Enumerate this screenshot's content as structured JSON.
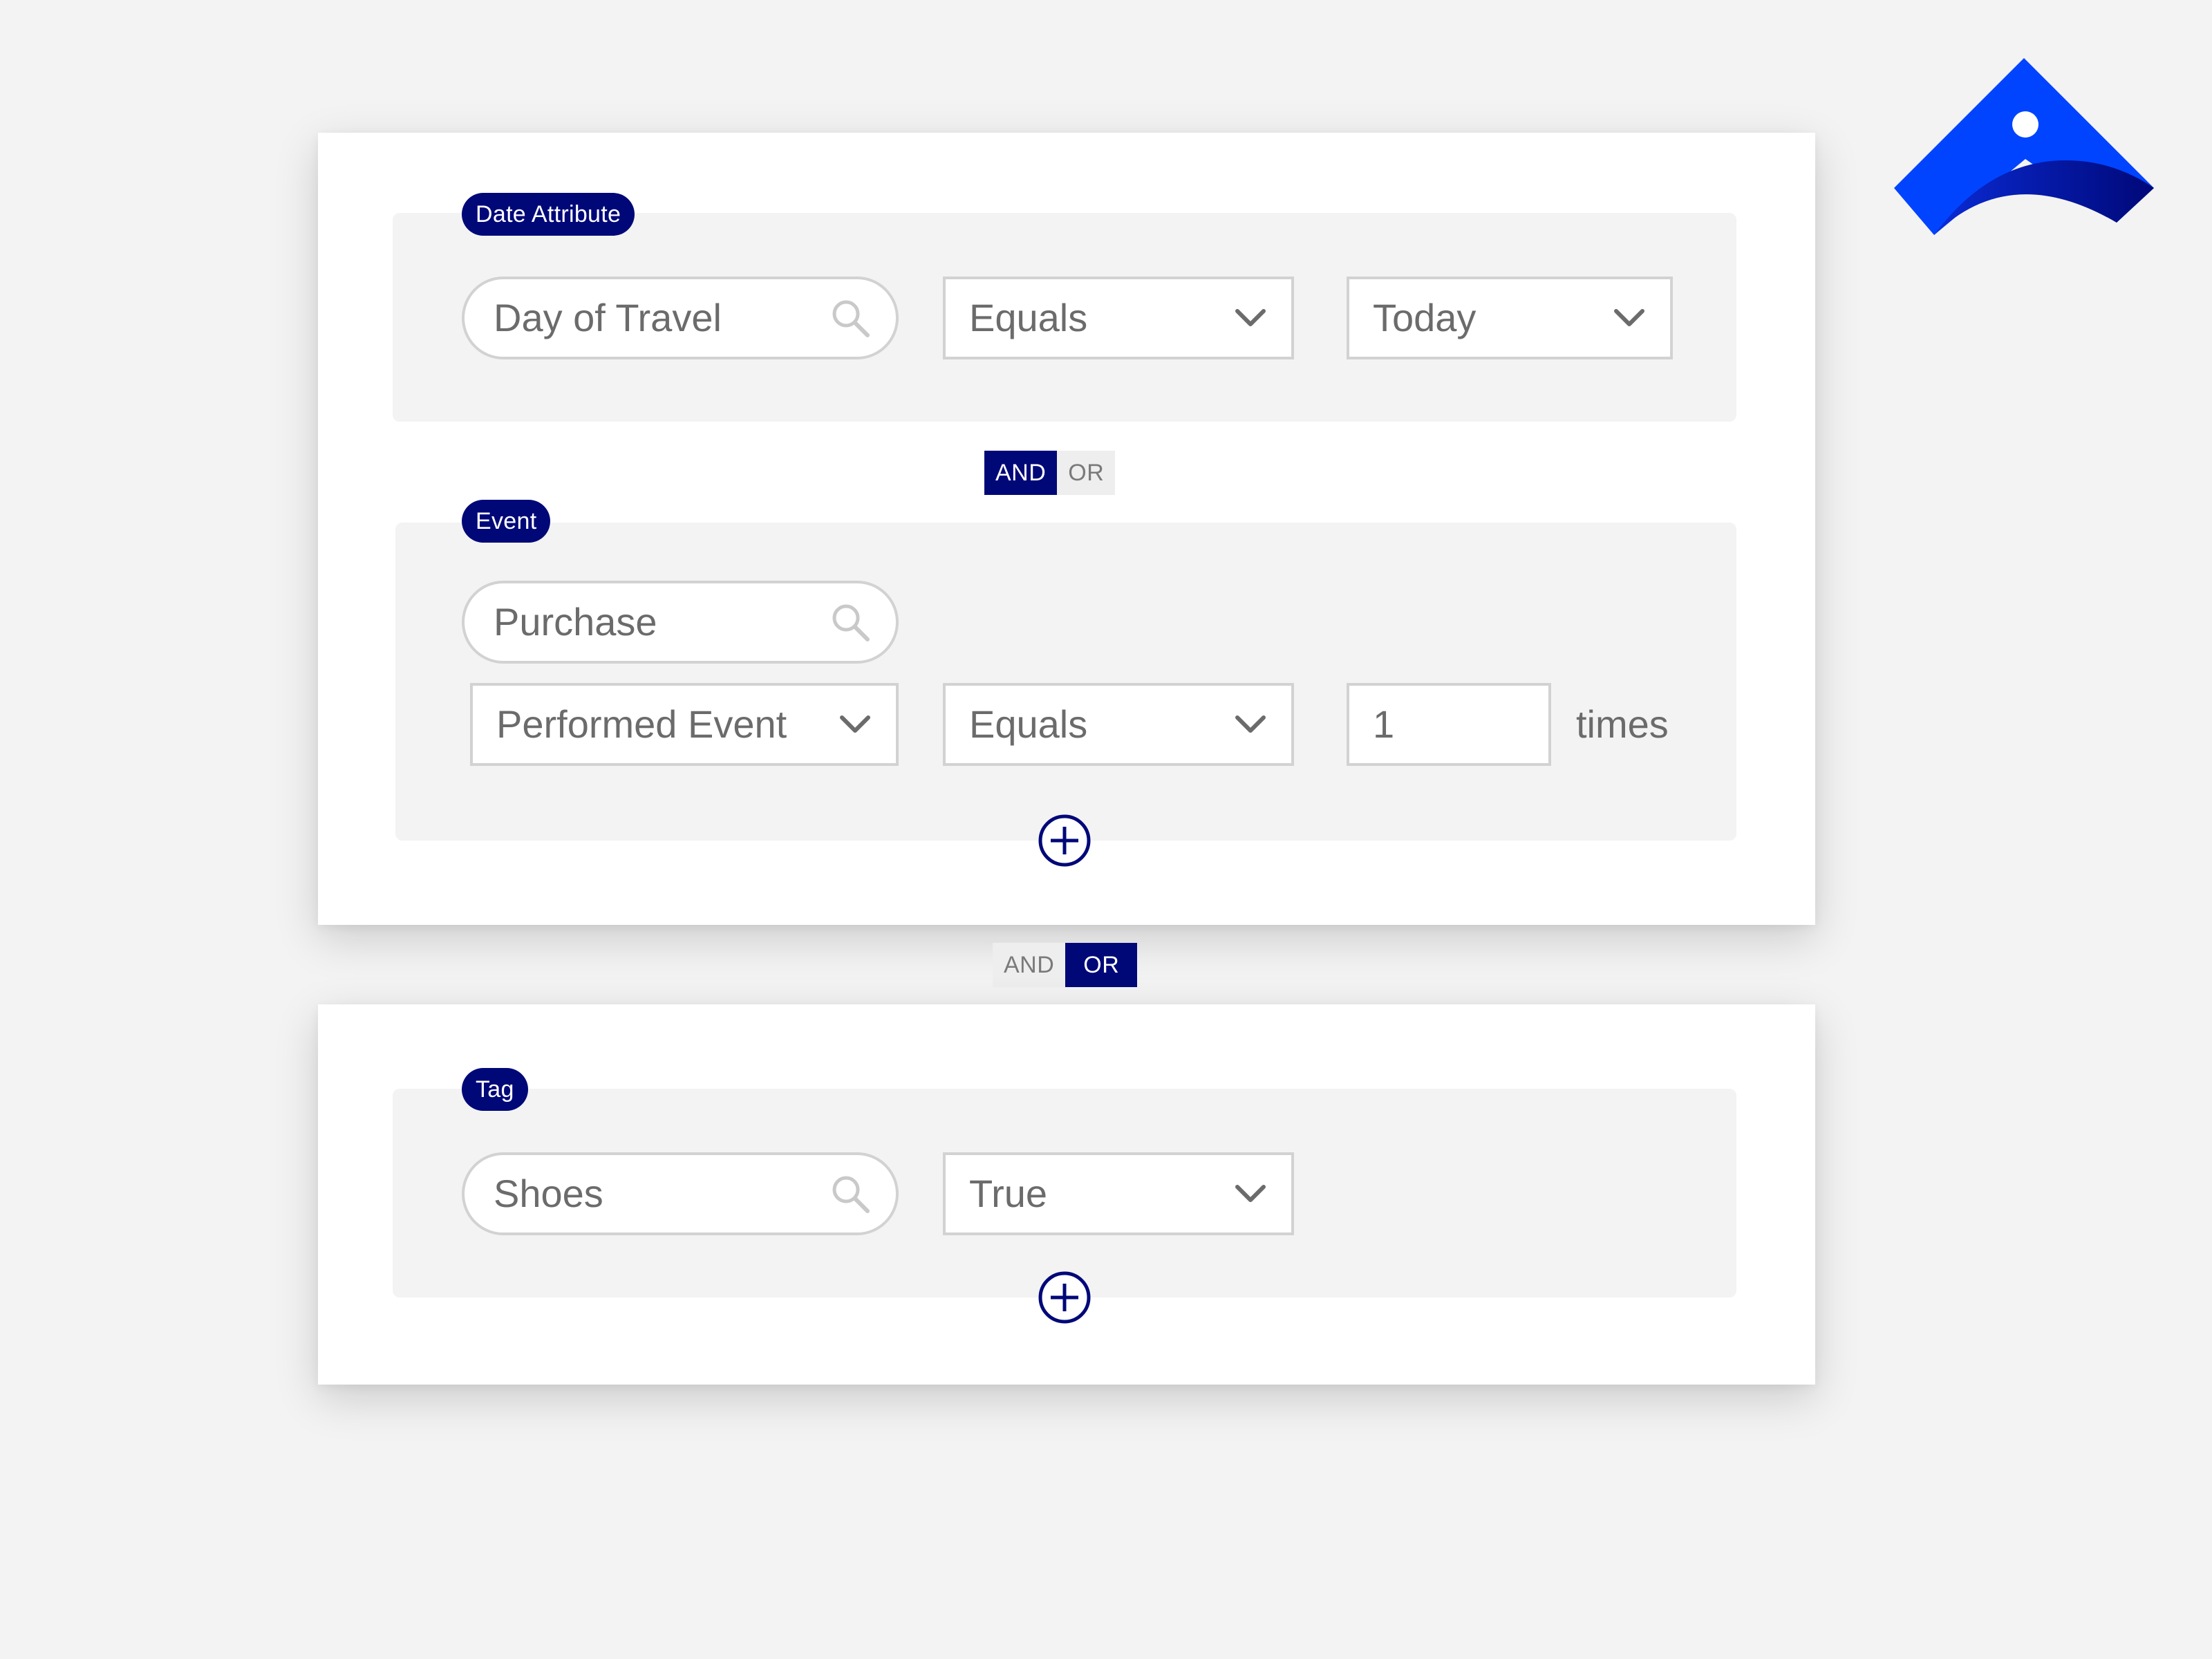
{
  "colors": {
    "background": "#f3f3f3",
    "panel": "#ffffff",
    "accent_navy": "#000878",
    "brand_blue": "#0044ff",
    "field_border": "#d2d2d2",
    "text_muted": "#6b6b6b"
  },
  "logo": {
    "icon": "brand-logo-icon"
  },
  "group1": {
    "tag": "Date Attribute",
    "search": {
      "value": "Day of Travel",
      "icon": "search-icon"
    },
    "operator": {
      "value": "Equals",
      "icon": "chevron-down-icon"
    },
    "date_value": {
      "value": "Today",
      "icon": "chevron-down-icon"
    }
  },
  "toggle1": {
    "and": "AND",
    "or": "OR",
    "selected": "AND"
  },
  "group2": {
    "tag": "Event",
    "search": {
      "value": "Purchase",
      "icon": "search-icon"
    },
    "event_type": {
      "value": "Performed Event",
      "icon": "chevron-down-icon"
    },
    "operator": {
      "value": "Equals",
      "icon": "chevron-down-icon"
    },
    "count": {
      "value": "1"
    },
    "times_label": "times",
    "add_icon": "plus-circle-icon"
  },
  "toggle2": {
    "and": "AND",
    "or": "OR",
    "selected": "OR"
  },
  "group3": {
    "tag": "Tag",
    "search": {
      "value": "Shoes",
      "icon": "search-icon"
    },
    "value_select": {
      "value": "True",
      "icon": "chevron-down-icon"
    },
    "add_icon": "plus-circle-icon"
  }
}
